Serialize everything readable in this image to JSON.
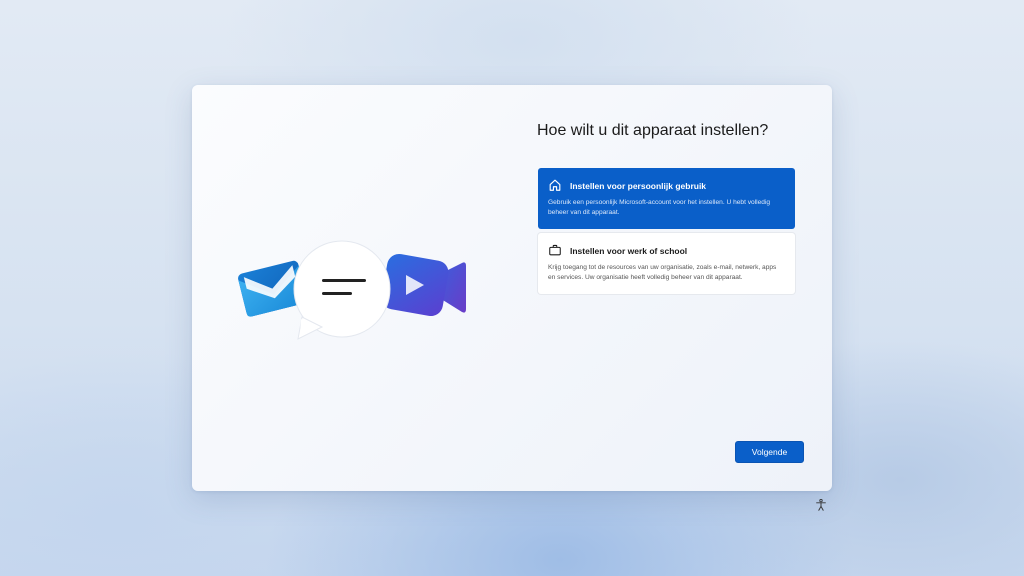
{
  "heading": "Hoe wilt u dit apparaat instellen?",
  "options": [
    {
      "title": "Instellen voor persoonlijk gebruik",
      "description": "Gebruik een persoonlijk Microsoft-account voor het instellen. U hebt volledig beheer van dit apparaat.",
      "icon": "home-icon",
      "selected": true
    },
    {
      "title": "Instellen voor werk of school",
      "description": "Krijg toegang tot de resources van uw organisatie, zoals e-mail, netwerk, apps en services. Uw organisatie heeft volledig beheer van dit apparaat.",
      "icon": "briefcase-icon",
      "selected": false
    }
  ],
  "next_button": "Volgende",
  "colors": {
    "accent": "#0a5fc9"
  }
}
